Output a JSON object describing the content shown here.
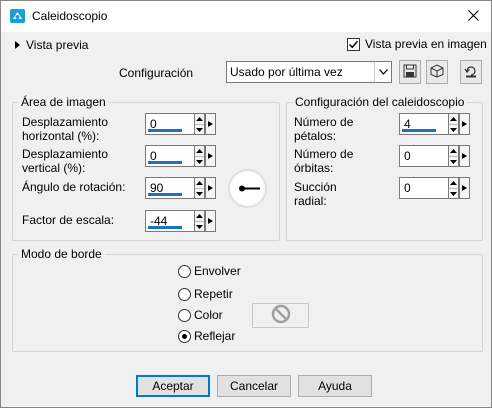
{
  "window": {
    "title": "Caleidoscopio"
  },
  "preview": {
    "toggle_label": "Vista previa",
    "image_preview_label": "Vista previa en imagen",
    "image_preview_checked": true
  },
  "config": {
    "label": "Configuración",
    "selected": "Usado por última vez"
  },
  "image_area": {
    "legend": "Área de imagen",
    "horiz_label_1": "Desplazamiento",
    "horiz_label_2": "horizontal (%):",
    "horiz_value": "0",
    "vert_label_1": "Desplazamiento",
    "vert_label_2": "vertical (%):",
    "vert_value": "0",
    "rotation_label": "Ángulo de rotación:",
    "rotation_value": "90",
    "scale_label": "Factor de escala:",
    "scale_value": "-44"
  },
  "kaleido_config": {
    "legend": "Configuración del caleidoscopio",
    "petals_label_1": "Número de",
    "petals_label_2": "pétalos:",
    "petals_value": "4",
    "orbits_label_1": "Número de",
    "orbits_label_2": "órbitas:",
    "orbits_value": "0",
    "suction_label_1": "Succión",
    "suction_label_2": "radial:",
    "suction_value": "0"
  },
  "edge_mode": {
    "legend": "Modo de borde",
    "options": [
      "Envolver",
      "Repetir",
      "Color",
      "Reflejar"
    ],
    "selected": "Reflejar"
  },
  "buttons": {
    "ok": "Aceptar",
    "cancel": "Cancelar",
    "help": "Ayuda"
  },
  "colors": {
    "accent": "#0078d7",
    "field_underline": "#1e73be",
    "app_icon": "#1a9fd8"
  },
  "icons": [
    "kaleidoscope-app-icon",
    "close-icon",
    "expand-triangle-icon",
    "checkmark-icon",
    "chevron-down-icon",
    "save-preset-icon",
    "cube-icon",
    "reset-icon",
    "up-arrow-icon",
    "down-arrow-icon",
    "dropdown-arrow-icon",
    "rotation-dial-icon",
    "no-symbol-icon"
  ]
}
